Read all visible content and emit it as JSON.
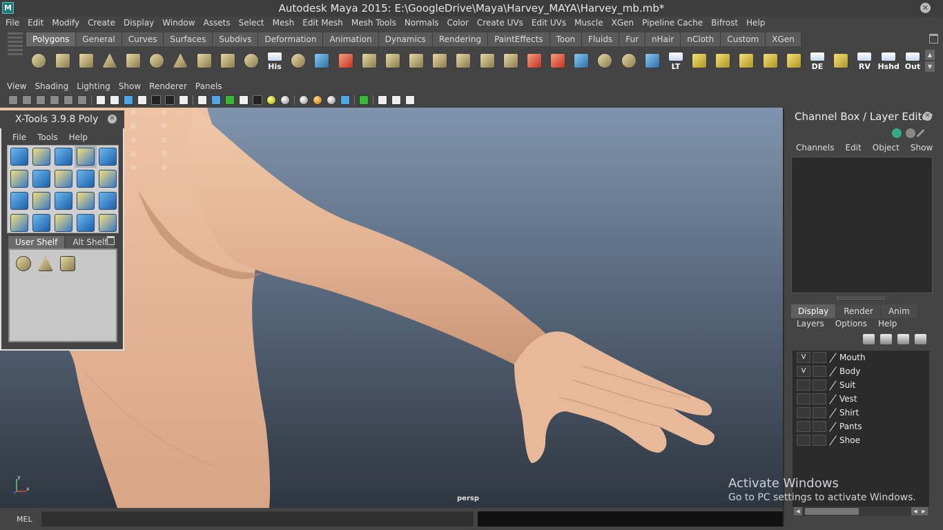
{
  "window": {
    "title": "Autodesk Maya 2015: E:\\GoogleDrive\\Maya\\Harvey_MAYA\\Harvey_mb.mb*",
    "app_icon": "M"
  },
  "main_menu": [
    "File",
    "Edit",
    "Modify",
    "Create",
    "Display",
    "Window",
    "Assets",
    "Select",
    "Mesh",
    "Edit Mesh",
    "Mesh Tools",
    "Normals",
    "Color",
    "Create UVs",
    "Edit UVs",
    "Muscle",
    "XGen",
    "Pipeline Cache",
    "Bifrost",
    "Help"
  ],
  "shelf_tabs": [
    "Polygons",
    "General",
    "Curves",
    "Surfaces",
    "Subdivs",
    "Deformation",
    "Animation",
    "Dynamics",
    "Rendering",
    "PaintEffects",
    "Toon",
    "Fluids",
    "Fur",
    "nHair",
    "nCloth",
    "Custom",
    "XGen"
  ],
  "shelf_active_tab": "Polygons",
  "shelf_icons": [
    {
      "name": "poly-sphere-icon",
      "style": "c",
      "label": ""
    },
    {
      "name": "poly-cube-icon",
      "style": "",
      "label": ""
    },
    {
      "name": "poly-cylinder-icon",
      "style": "",
      "label": ""
    },
    {
      "name": "poly-cone-icon",
      "style": "p",
      "label": ""
    },
    {
      "name": "poly-plane-icon",
      "style": "",
      "label": ""
    },
    {
      "name": "poly-torus-icon",
      "style": "c",
      "label": ""
    },
    {
      "name": "poly-pyramid-icon",
      "style": "p",
      "label": ""
    },
    {
      "name": "poly-pipe-icon",
      "style": "",
      "label": ""
    },
    {
      "name": "poly-helix-icon",
      "style": "",
      "label": ""
    },
    {
      "name": "poly-soccer-ball-icon",
      "style": "c",
      "label": ""
    },
    {
      "name": "history-icon",
      "style": "",
      "label": "His"
    },
    {
      "name": "combine-icon",
      "style": "c",
      "label": ""
    },
    {
      "name": "separate-icon",
      "style": "b",
      "label": ""
    },
    {
      "name": "extract-icon",
      "style": "r",
      "label": ""
    },
    {
      "name": "smooth-icon",
      "style": "",
      "label": ""
    },
    {
      "name": "extrude-icon",
      "style": "",
      "label": ""
    },
    {
      "name": "bridge-icon",
      "style": "",
      "label": ""
    },
    {
      "name": "append-icon",
      "style": "",
      "label": ""
    },
    {
      "name": "split-icon",
      "style": "",
      "label": ""
    },
    {
      "name": "insert-edge-loop-icon",
      "style": "",
      "label": ""
    },
    {
      "name": "offset-edge-loop-icon",
      "style": "",
      "label": ""
    },
    {
      "name": "sculpt-icon",
      "style": "r",
      "label": ""
    },
    {
      "name": "paint-tool-icon",
      "style": "r",
      "label": ""
    },
    {
      "name": "wireframe-icon",
      "style": "b",
      "label": ""
    },
    {
      "name": "manipulator-icon",
      "style": "c",
      "label": ""
    },
    {
      "name": "rotate-manipulator-icon",
      "style": "c",
      "label": ""
    },
    {
      "name": "transfer-icon",
      "style": "b",
      "label": ""
    },
    {
      "name": "lt-icon",
      "style": "",
      "label": "LT"
    },
    {
      "name": "uv-layout-icon",
      "style": "y",
      "label": ""
    },
    {
      "name": "uv-unfold-icon",
      "style": "y",
      "label": ""
    },
    {
      "name": "uv-cut-icon",
      "style": "y",
      "label": ""
    },
    {
      "name": "uv-sew-icon",
      "style": "y",
      "label": ""
    },
    {
      "name": "uv-move-icon",
      "style": "y",
      "label": ""
    },
    {
      "name": "de-icon",
      "style": "b",
      "label": "DE"
    },
    {
      "name": "uv-grid-icon",
      "style": "y",
      "label": ""
    },
    {
      "name": "rv-icon",
      "style": "",
      "label": "RV"
    },
    {
      "name": "hshd-icon",
      "style": "",
      "label": "Hshd"
    },
    {
      "name": "out-icon",
      "style": "",
      "label": "Out"
    }
  ],
  "panel_menu": [
    "View",
    "Shading",
    "Lighting",
    "Show",
    "Renderer",
    "Panels"
  ],
  "viewport": {
    "camera": "persp",
    "hud_values": [
      [
        "0",
        "0"
      ],
      [
        "0",
        "0"
      ],
      [
        "0",
        "0"
      ],
      [
        "0",
        "0"
      ],
      [
        "0",
        "0"
      ]
    ],
    "axis_y": "y",
    "axis_x": "x"
  },
  "xtools": {
    "title": "X-Tools 3.9.8 Poly",
    "menu": [
      "File",
      "Tools",
      "Help"
    ],
    "tabs": [
      "User Shelf",
      "Alt Shelf"
    ],
    "active_tab": "User Shelf",
    "tool_icons": [
      "merge-icon",
      "grid-icon",
      "slide-icon",
      "select-icon",
      "lift-icon",
      "flip-icon",
      "split-grid-icon",
      "plane-icon",
      "bevel-icon",
      "spike-icon",
      "pinch-icon",
      "transform-icon",
      "cut-icon",
      "sphere-icon",
      "tool-icon",
      "cube-icon",
      "fill-icon",
      "align-icon",
      "mirror-icon",
      "bend-icon"
    ],
    "shelf_icons": [
      "rotate-icon",
      "cone-icon",
      "plane-icon"
    ]
  },
  "channel_box": {
    "title": "Channel Box / Layer Editor",
    "menu": [
      "Channels",
      "Edit",
      "Object",
      "Show"
    ]
  },
  "layer_editor": {
    "tabs": [
      "Display",
      "Render",
      "Anim"
    ],
    "active_tab": "Display",
    "menu": [
      "Layers",
      "Options",
      "Help"
    ],
    "layers": [
      {
        "name": "Mouth",
        "visible": "V"
      },
      {
        "name": "Body",
        "visible": "V"
      },
      {
        "name": "Suit",
        "visible": ""
      },
      {
        "name": "Vest",
        "visible": ""
      },
      {
        "name": "Shirt",
        "visible": ""
      },
      {
        "name": "Pants",
        "visible": ""
      },
      {
        "name": "Shoe",
        "visible": ""
      }
    ]
  },
  "watermark": {
    "title": "Activate Windows",
    "subtitle": "Go to PC settings to activate Windows."
  },
  "command_line": {
    "label": "MEL",
    "value": ""
  },
  "colors": {
    "skin": "#e6b694",
    "viewport_top": "#7f95ad",
    "viewport_bottom": "#2e3640",
    "active_tab": "#686868"
  }
}
